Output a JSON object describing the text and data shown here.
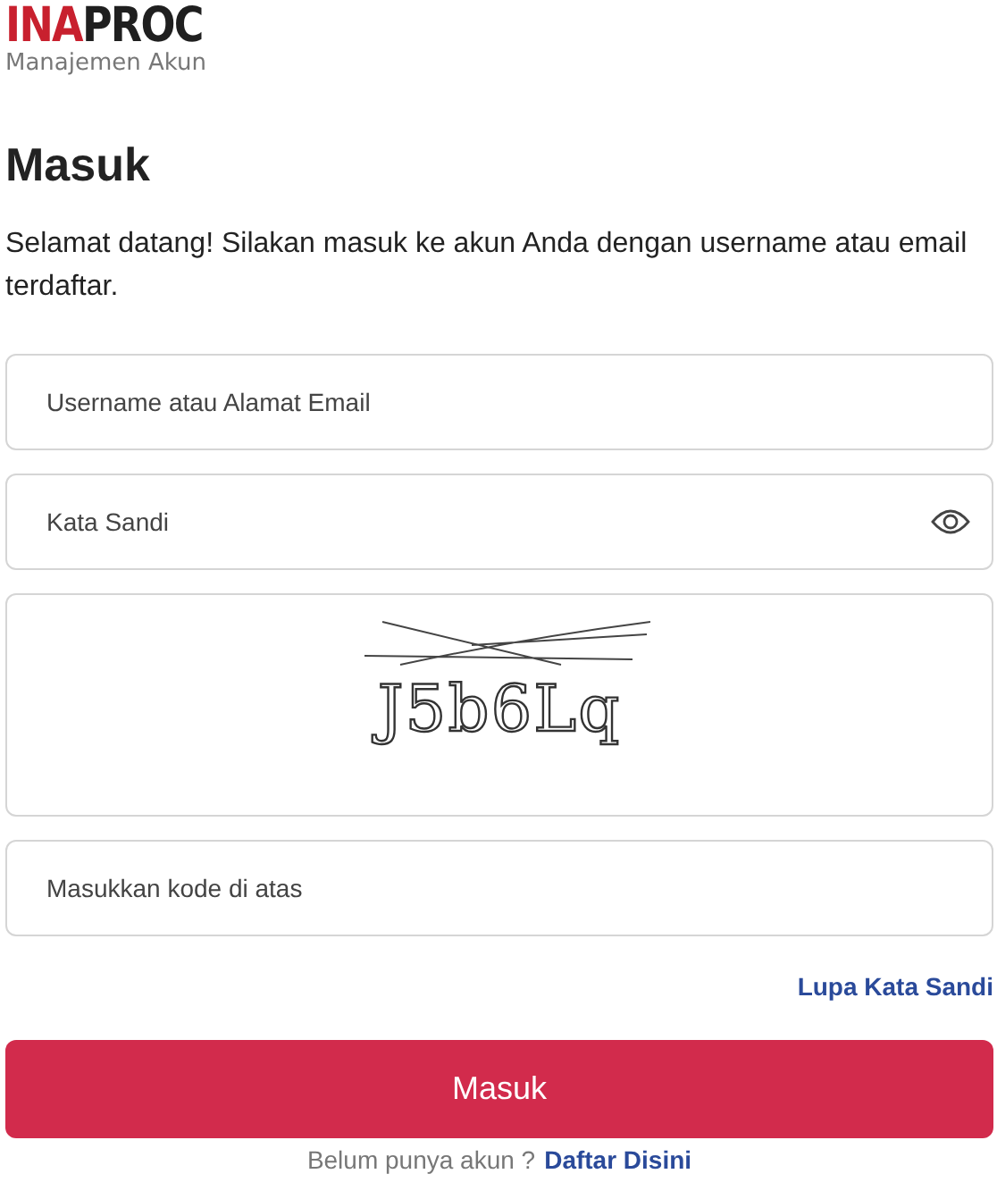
{
  "logo": {
    "parts": [
      {
        "text": "INA",
        "color": "#c8202e"
      },
      {
        "text": "PROC",
        "color": "#1f1f1f"
      }
    ],
    "subtitle": "Manajemen Akun"
  },
  "heading": "Masuk",
  "intro": "Selamat datang! Silakan masuk ke akun Anda dengan username atau email terdaftar.",
  "fields": [
    {
      "kind": "text",
      "placeholder": "Username atau Alamat Email"
    },
    {
      "kind": "password",
      "placeholder": "Kata Sandi"
    },
    {
      "kind": "captcha",
      "code": "J5b6Lq"
    },
    {
      "kind": "text",
      "placeholder": "Masukkan kode di atas"
    }
  ],
  "forgot_link": "Lupa Kata Sandi",
  "submit_button": "Masuk",
  "register": {
    "text": "Belum punya akun ?",
    "link": "Daftar Disini"
  }
}
